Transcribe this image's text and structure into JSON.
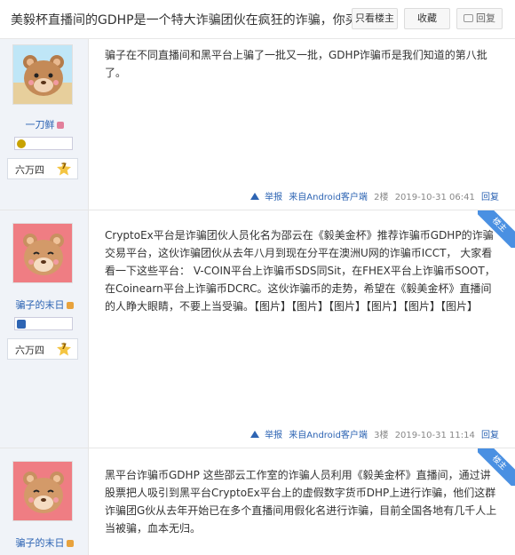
{
  "header": {
    "title": "美毅杯直播间的GDHP是一个特大诈骗团伙在疯狂的诈骗，你买了",
    "only_owner": "只看楼主",
    "favorite": "收藏",
    "reply": "回复"
  },
  "posts": [
    {
      "username": "一刀鲜",
      "rank_text": "六万四",
      "rank_level": "7",
      "content": "骗子在不同直播间和黑平台上骗了一批又一批，GDHP诈骗币是我们知道的第八批了。",
      "report": "举报",
      "client": "来自Android客户端",
      "floor": "2楼",
      "time": "2019-10-31 06:41",
      "reply": "回复",
      "level_color": "#c8a200"
    },
    {
      "username": "骗子的末日",
      "corner_label": "楼主",
      "rank_text": "六万四",
      "rank_level": "7",
      "content": "CryptoEx平台是诈骗团伙人员化名为邵云在《毅美金杯》推荐诈骗币GDHP的诈骗交易平台，这伙诈骗团伙从去年八月到现在分平在澳洲U网的诈骗币ICCT， 大家看看一下这些平台： V-COIN平台上诈骗币SDS同Sit，在FHEX平台上诈骗币SOOT，在Coinearn平台上诈骗币DCRC。这伙诈骗币的走势，希望在《毅美金杯》直播间的人睁大眼睛，不要上当受骗。【图片】【图片】【图片】【图片】【图片】【图片】",
      "report": "举报",
      "client": "来自Android客户端",
      "floor": "3楼",
      "time": "2019-10-31 11:14",
      "reply": "回复",
      "level_color": "#2d64b3"
    },
    {
      "username": "骗子的末日",
      "corner_label": "楼主",
      "content": "黑平台诈骗币GDHP 这些邵云工作室的诈骗人员利用《毅美金杯》直播间，通过讲股票把人吸引到黑平台CryptoEx平台上的虚假数字货币DHP上进行诈骗，他们这群诈骗团G伙从去年开始已在多个直播间用假化名进行诈骗，目前全国各地有几千人上当被骗，血本无归。"
    }
  ],
  "colors": {
    "link": "#2d64b3",
    "sidebar_bg": "#f0f3f8",
    "corner_blue": "#4a90e2"
  }
}
